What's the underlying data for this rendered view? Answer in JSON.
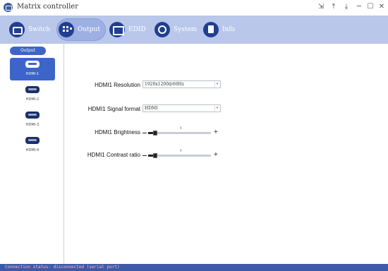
{
  "window": {
    "title": "Matrix controller",
    "controls": [
      "⇲",
      "⤒",
      "⤓",
      "─",
      "☐",
      "✕"
    ]
  },
  "toolbar": {
    "tabs": [
      {
        "label": "Switch",
        "icon": "switch-icon",
        "active": false
      },
      {
        "label": "Output",
        "icon": "output-icon",
        "active": true
      },
      {
        "label": "EDID",
        "icon": "edid-icon",
        "active": false
      },
      {
        "label": "System",
        "icon": "system-icon",
        "active": false
      },
      {
        "label": "Info",
        "icon": "info-icon",
        "active": false
      }
    ]
  },
  "sidebar": {
    "header": "Output",
    "items": [
      {
        "label": "HDMI-1",
        "active": true
      },
      {
        "label": "HDMI-2",
        "active": false
      },
      {
        "label": "HDMI-3",
        "active": false
      },
      {
        "label": "HDMI-4",
        "active": false
      }
    ]
  },
  "settings": {
    "resolution": {
      "label": "HDMI1 Resolution",
      "value": "1920x1200@60Hz"
    },
    "signal_format": {
      "label": "HDMI1 Signal format",
      "value": "HDMI"
    },
    "brightness": {
      "label": "HDMI1 Brightness",
      "value": "9",
      "level": 9,
      "max": 100
    },
    "contrast": {
      "label": "HDMI1 Contrast ratio",
      "value": "9",
      "level": 9,
      "max": 100
    }
  },
  "status": {
    "text": "Connection status: disconnected (serial port)"
  },
  "colors": {
    "accent": "#3d64c8",
    "toolbar_bg": "#b8c7ea",
    "status_bg": "#3d5aa8",
    "status_text": "#ffbdbd"
  }
}
